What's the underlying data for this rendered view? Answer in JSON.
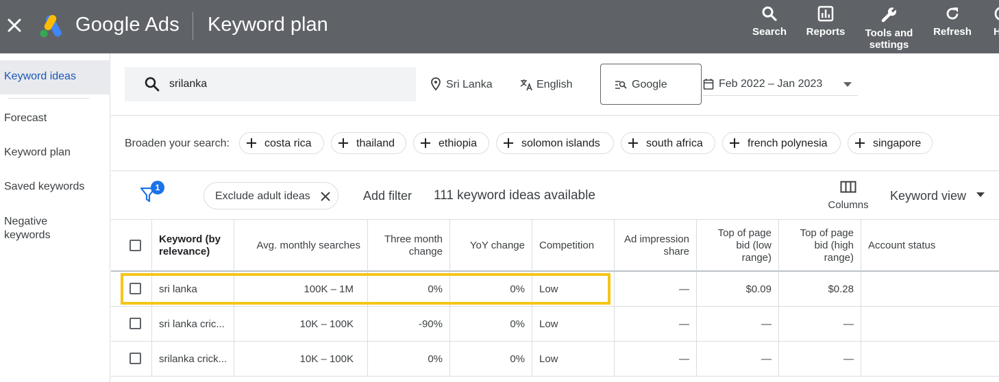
{
  "topbar": {
    "brand": "Google Ads",
    "page_title": "Keyword plan",
    "tools": [
      {
        "label": "Search",
        "icon": "search-icon"
      },
      {
        "label": "Reports",
        "icon": "reports-icon"
      },
      {
        "label": "Tools and settings",
        "icon": "wrench-icon"
      },
      {
        "label": "Refresh",
        "icon": "refresh-icon"
      },
      {
        "label": "H",
        "icon": "help-icon"
      }
    ]
  },
  "sidebar": {
    "items": [
      {
        "label": "Keyword ideas",
        "active": true
      },
      {
        "label": "Forecast"
      },
      {
        "label": "Keyword plan"
      },
      {
        "label": "Saved keywords"
      },
      {
        "label": "Negative keywords"
      }
    ]
  },
  "search": {
    "query": "srilanka",
    "location": "Sri Lanka",
    "language": "English",
    "network": "Google",
    "date_range": "Feb 2022 – Jan 2023"
  },
  "broaden": {
    "label": "Broaden your search:",
    "chips": [
      "costa rica",
      "thailand",
      "ethiopia",
      "solomon islands",
      "south africa",
      "french polynesia",
      "singapore"
    ]
  },
  "filters": {
    "badge_count": "1",
    "exclude_chip": "Exclude adult ideas",
    "add_filter": "Add filter",
    "ideas_count": "111 keyword ideas available",
    "columns": "Columns",
    "view": "Keyword view"
  },
  "table": {
    "headers": {
      "keyword": "Keyword (by relevance)",
      "avg": "Avg. monthly searches",
      "three_month": "Three month change",
      "yoy": "YoY change",
      "competition": "Competition",
      "ad_impression": "Ad impression share",
      "top_low": "Top of page bid (low range)",
      "top_high": "Top of page bid (high range)",
      "account_status": "Account status"
    },
    "rows": [
      {
        "keyword": "sri lanka",
        "avg": "100K – 1M",
        "three_month": "0%",
        "yoy": "0%",
        "competition": "Low",
        "ad_impression": "—",
        "top_low": "$0.09",
        "top_high": "$0.28"
      },
      {
        "keyword": "sri lanka cric...",
        "avg": "10K – 100K",
        "three_month": "-90%",
        "yoy": "0%",
        "competition": "Low",
        "ad_impression": "—",
        "top_low": "—",
        "top_high": "—"
      },
      {
        "keyword": "srilanka crick...",
        "avg": "10K – 100K",
        "three_month": "0%",
        "yoy": "0%",
        "competition": "Low",
        "ad_impression": "—",
        "top_low": "—",
        "top_high": "—"
      }
    ]
  },
  "colors": {
    "topbar": "#5f6368",
    "accent_blue": "#1a73e8",
    "highlight": "#f5c518"
  }
}
